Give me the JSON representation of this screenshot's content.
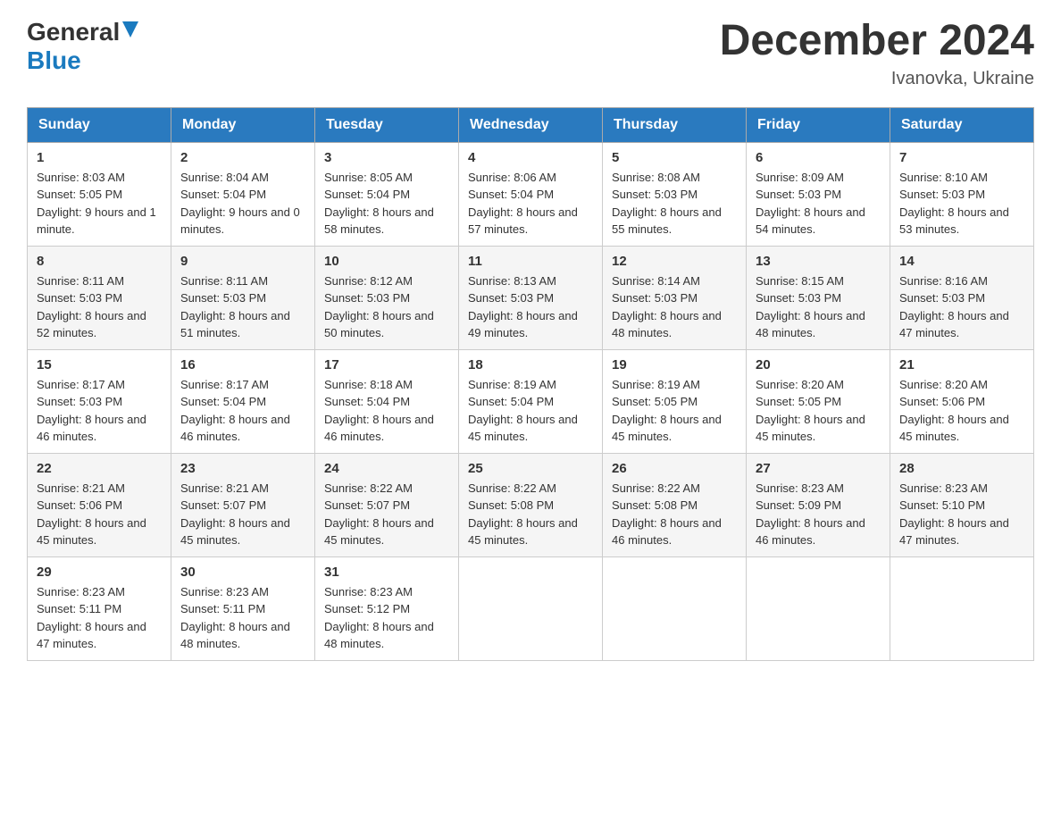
{
  "logo": {
    "general": "General",
    "blue": "Blue",
    "triangle_color": "#1a7abf"
  },
  "header": {
    "month_year": "December 2024",
    "location": "Ivanovka, Ukraine"
  },
  "days_of_week": [
    "Sunday",
    "Monday",
    "Tuesday",
    "Wednesday",
    "Thursday",
    "Friday",
    "Saturday"
  ],
  "weeks": [
    [
      {
        "day": "1",
        "sunrise": "8:03 AM",
        "sunset": "5:05 PM",
        "daylight": "9 hours and 1 minute."
      },
      {
        "day": "2",
        "sunrise": "8:04 AM",
        "sunset": "5:04 PM",
        "daylight": "9 hours and 0 minutes."
      },
      {
        "day": "3",
        "sunrise": "8:05 AM",
        "sunset": "5:04 PM",
        "daylight": "8 hours and 58 minutes."
      },
      {
        "day": "4",
        "sunrise": "8:06 AM",
        "sunset": "5:04 PM",
        "daylight": "8 hours and 57 minutes."
      },
      {
        "day": "5",
        "sunrise": "8:08 AM",
        "sunset": "5:03 PM",
        "daylight": "8 hours and 55 minutes."
      },
      {
        "day": "6",
        "sunrise": "8:09 AM",
        "sunset": "5:03 PM",
        "daylight": "8 hours and 54 minutes."
      },
      {
        "day": "7",
        "sunrise": "8:10 AM",
        "sunset": "5:03 PM",
        "daylight": "8 hours and 53 minutes."
      }
    ],
    [
      {
        "day": "8",
        "sunrise": "8:11 AM",
        "sunset": "5:03 PM",
        "daylight": "8 hours and 52 minutes."
      },
      {
        "day": "9",
        "sunrise": "8:11 AM",
        "sunset": "5:03 PM",
        "daylight": "8 hours and 51 minutes."
      },
      {
        "day": "10",
        "sunrise": "8:12 AM",
        "sunset": "5:03 PM",
        "daylight": "8 hours and 50 minutes."
      },
      {
        "day": "11",
        "sunrise": "8:13 AM",
        "sunset": "5:03 PM",
        "daylight": "8 hours and 49 minutes."
      },
      {
        "day": "12",
        "sunrise": "8:14 AM",
        "sunset": "5:03 PM",
        "daylight": "8 hours and 48 minutes."
      },
      {
        "day": "13",
        "sunrise": "8:15 AM",
        "sunset": "5:03 PM",
        "daylight": "8 hours and 48 minutes."
      },
      {
        "day": "14",
        "sunrise": "8:16 AM",
        "sunset": "5:03 PM",
        "daylight": "8 hours and 47 minutes."
      }
    ],
    [
      {
        "day": "15",
        "sunrise": "8:17 AM",
        "sunset": "5:03 PM",
        "daylight": "8 hours and 46 minutes."
      },
      {
        "day": "16",
        "sunrise": "8:17 AM",
        "sunset": "5:04 PM",
        "daylight": "8 hours and 46 minutes."
      },
      {
        "day": "17",
        "sunrise": "8:18 AM",
        "sunset": "5:04 PM",
        "daylight": "8 hours and 46 minutes."
      },
      {
        "day": "18",
        "sunrise": "8:19 AM",
        "sunset": "5:04 PM",
        "daylight": "8 hours and 45 minutes."
      },
      {
        "day": "19",
        "sunrise": "8:19 AM",
        "sunset": "5:05 PM",
        "daylight": "8 hours and 45 minutes."
      },
      {
        "day": "20",
        "sunrise": "8:20 AM",
        "sunset": "5:05 PM",
        "daylight": "8 hours and 45 minutes."
      },
      {
        "day": "21",
        "sunrise": "8:20 AM",
        "sunset": "5:06 PM",
        "daylight": "8 hours and 45 minutes."
      }
    ],
    [
      {
        "day": "22",
        "sunrise": "8:21 AM",
        "sunset": "5:06 PM",
        "daylight": "8 hours and 45 minutes."
      },
      {
        "day": "23",
        "sunrise": "8:21 AM",
        "sunset": "5:07 PM",
        "daylight": "8 hours and 45 minutes."
      },
      {
        "day": "24",
        "sunrise": "8:22 AM",
        "sunset": "5:07 PM",
        "daylight": "8 hours and 45 minutes."
      },
      {
        "day": "25",
        "sunrise": "8:22 AM",
        "sunset": "5:08 PM",
        "daylight": "8 hours and 45 minutes."
      },
      {
        "day": "26",
        "sunrise": "8:22 AM",
        "sunset": "5:08 PM",
        "daylight": "8 hours and 46 minutes."
      },
      {
        "day": "27",
        "sunrise": "8:23 AM",
        "sunset": "5:09 PM",
        "daylight": "8 hours and 46 minutes."
      },
      {
        "day": "28",
        "sunrise": "8:23 AM",
        "sunset": "5:10 PM",
        "daylight": "8 hours and 47 minutes."
      }
    ],
    [
      {
        "day": "29",
        "sunrise": "8:23 AM",
        "sunset": "5:11 PM",
        "daylight": "8 hours and 47 minutes."
      },
      {
        "day": "30",
        "sunrise": "8:23 AM",
        "sunset": "5:11 PM",
        "daylight": "8 hours and 48 minutes."
      },
      {
        "day": "31",
        "sunrise": "8:23 AM",
        "sunset": "5:12 PM",
        "daylight": "8 hours and 48 minutes."
      },
      null,
      null,
      null,
      null
    ]
  ],
  "labels": {
    "sunrise": "Sunrise:",
    "sunset": "Sunset:",
    "daylight": "Daylight:"
  }
}
